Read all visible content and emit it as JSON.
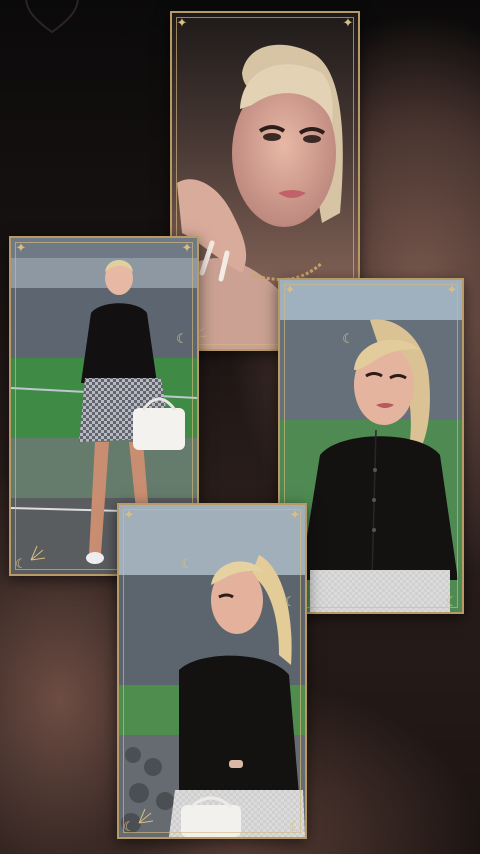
{
  "collage": {
    "photos": [
      {
        "id": "selfie-closeup",
        "scene": "close-up selfie"
      },
      {
        "id": "stadium-full-body",
        "scene": "full body at stadium"
      },
      {
        "id": "stadium-portrait",
        "scene": "portrait at stadium"
      },
      {
        "id": "stadium-side-view",
        "scene": "side view at stadium"
      }
    ],
    "colors": {
      "frame": "#b89a66",
      "accent": "#d8bd84",
      "background": "#1a1311"
    },
    "icons": [
      "heart-icon",
      "sun-ray-ornament",
      "moon-ornament",
      "star-ornament"
    ]
  }
}
